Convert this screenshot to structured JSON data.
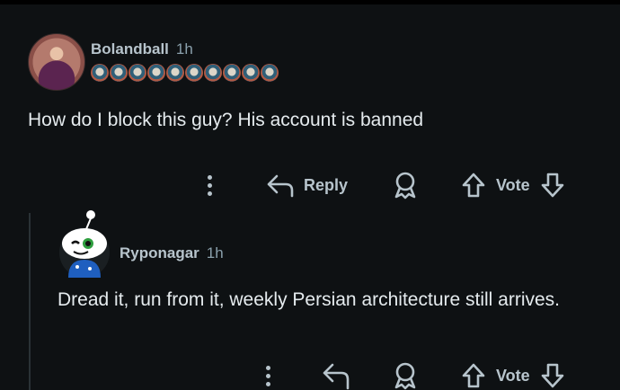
{
  "comments": [
    {
      "username": "Bolandball",
      "time": "1h",
      "text": "How do I block this guy? His account is banned",
      "actions": {
        "reply_label": "Reply",
        "vote_label": "Vote"
      },
      "flair_icon": "award-badge-icon",
      "flair_count": 10
    },
    {
      "username": "Ryponagar",
      "time": "1h",
      "text": "Dread it, run from it, weekly Persian architecture still arrives.",
      "actions": {
        "vote_label": "Vote"
      }
    }
  ],
  "colors": {
    "background": "#0e1113",
    "text": "#e5ebee",
    "muted": "#b7c4cc",
    "thread_line": "#2a3236"
  }
}
